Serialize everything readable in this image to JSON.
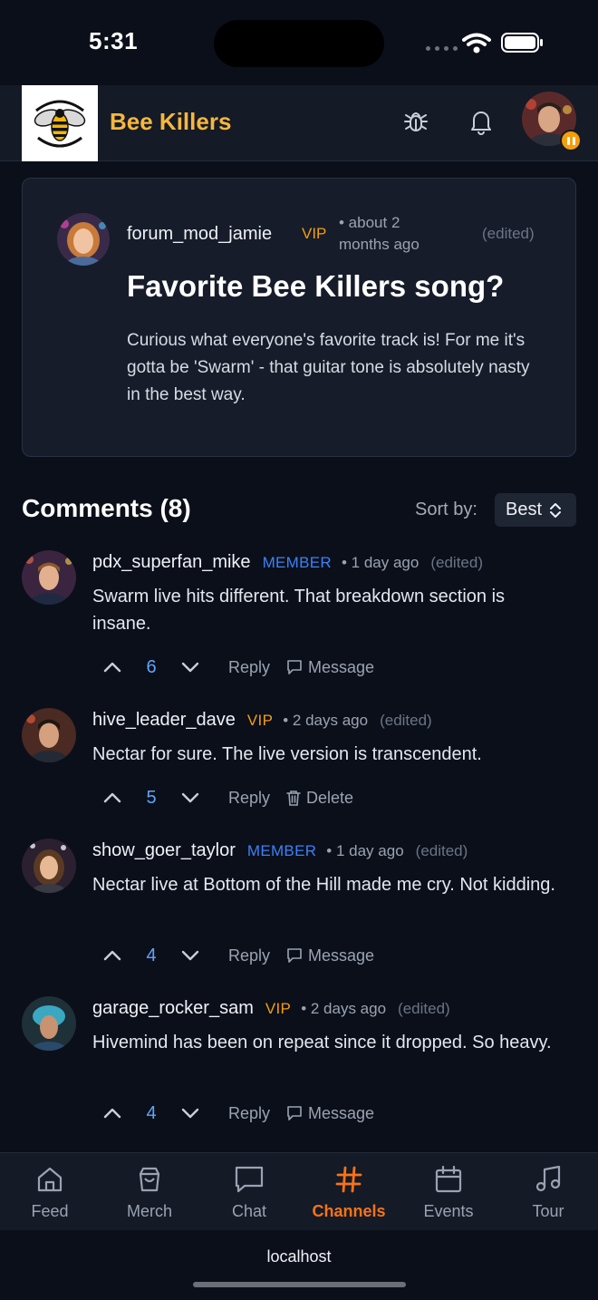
{
  "status_bar": {
    "time": "5:31"
  },
  "header": {
    "brand": "Bee Killers"
  },
  "post": {
    "author": "forum_mod_jamie",
    "badge": "VIP",
    "time": "• about 2 months ago",
    "edited": "(edited)",
    "title": "Favorite Bee Killers song?",
    "body": "Curious what everyone's favorite track is! For me it's gotta be 'Swarm' - that guitar tone is absolutely nasty in the best way."
  },
  "comments_header": {
    "title": "Comments (8)",
    "sort_label": "Sort by:",
    "sort_value": "Best"
  },
  "comments": [
    {
      "author": "pdx_superfan_mike",
      "badge": "MEMBER",
      "time": "• 1 day ago",
      "edited": "(edited)",
      "text": "Swarm live hits different. That breakdown section is insane.",
      "score": "6",
      "reply": "Reply",
      "second_action": "Message"
    },
    {
      "author": "hive_leader_dave",
      "badge": "VIP",
      "time": "• 2 days ago",
      "edited": "(edited)",
      "text": "Nectar for sure. The live version is transcendent.",
      "score": "5",
      "reply": "Reply",
      "second_action": "Delete"
    },
    {
      "author": "show_goer_taylor",
      "badge": "MEMBER",
      "time": "• 1 day ago",
      "edited": "(edited)",
      "text": "Nectar live at Bottom of the Hill made me cry. Not kidding.",
      "score": "4",
      "reply": "Reply",
      "second_action": "Message"
    },
    {
      "author": "garage_rocker_sam",
      "badge": "VIP",
      "time": "• 2 days ago",
      "edited": "(edited)",
      "text": "Hivemind has been on repeat since it dropped. So heavy.",
      "score": "4",
      "reply": "Reply",
      "second_action": "Message"
    }
  ],
  "tabs": [
    {
      "label": "Feed",
      "icon": "home-icon"
    },
    {
      "label": "Merch",
      "icon": "shopping-bag-icon"
    },
    {
      "label": "Chat",
      "icon": "chat-icon"
    },
    {
      "label": "Channels",
      "icon": "hash-icon",
      "active": true
    },
    {
      "label": "Events",
      "icon": "calendar-icon"
    },
    {
      "label": "Tour",
      "icon": "music-note-icon"
    }
  ],
  "browser": {
    "url": "localhost"
  },
  "colors": {
    "accent": "#f97316",
    "brand": "#f6b73c",
    "vip": "#f59e0b",
    "member": "#3b82f6",
    "score": "#60a5fa",
    "background": "#0b0f1a"
  }
}
